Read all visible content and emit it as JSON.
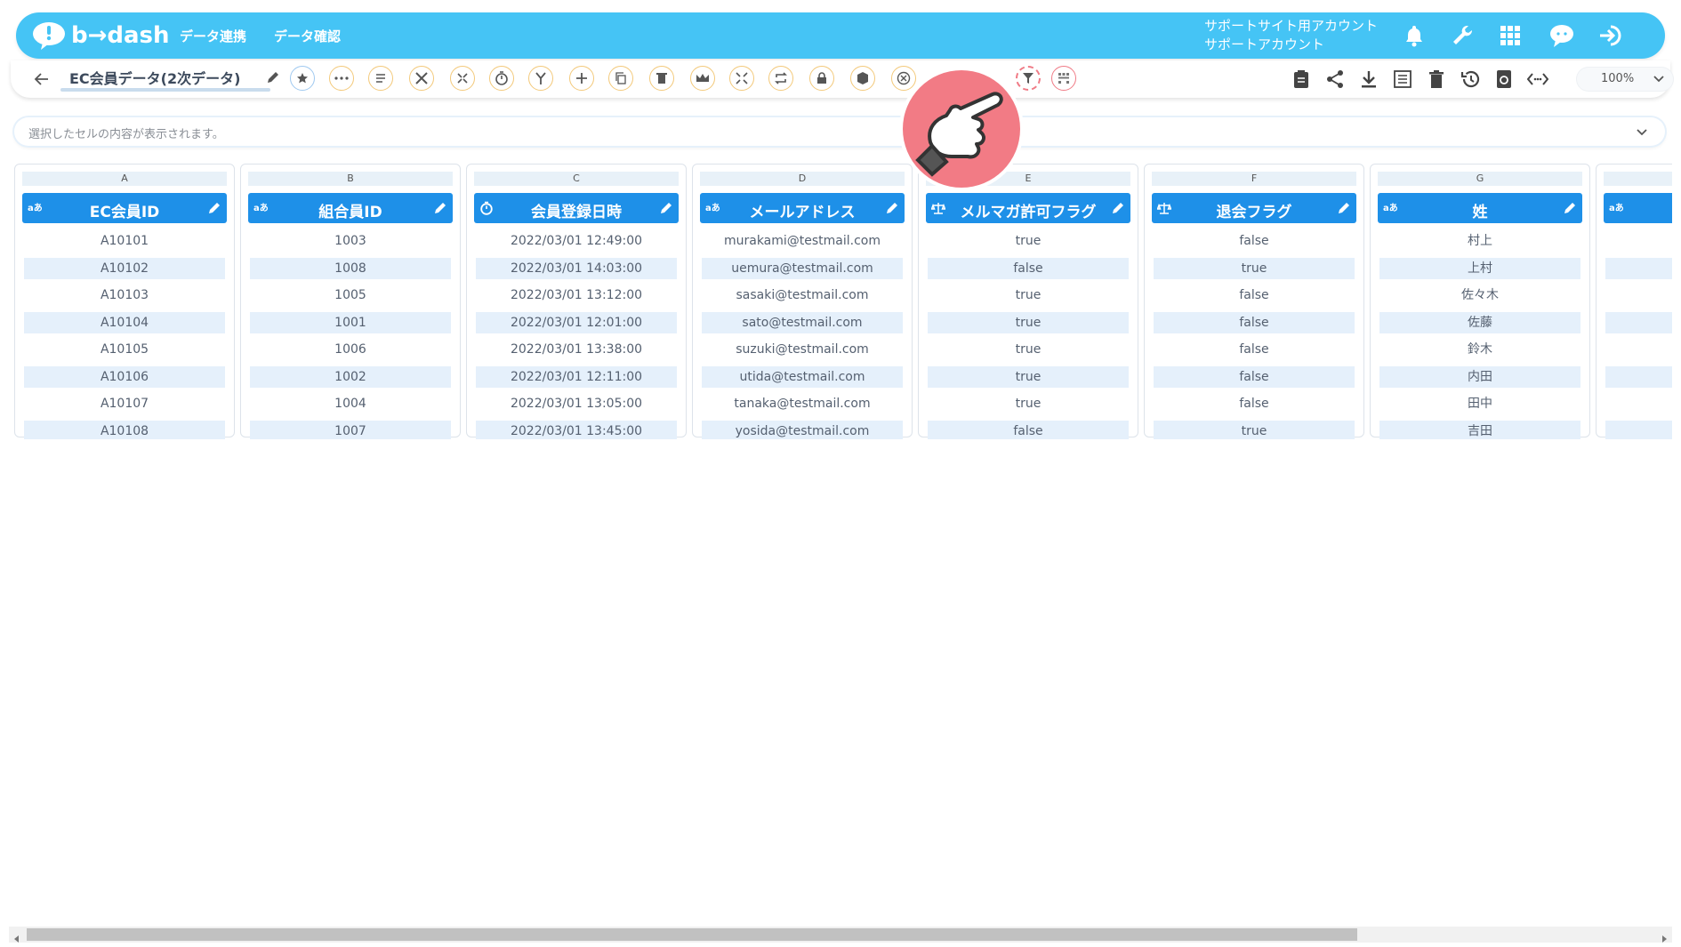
{
  "header": {
    "logo_text": "b→dash",
    "nav": [
      "データ連携",
      "データ確認"
    ],
    "account_line1": "サポートサイト用アカウント",
    "account_line2": "サポートアカウント"
  },
  "toolbar": {
    "title": "EC会員データ(2次データ)",
    "zoom": "100%"
  },
  "cellbar": {
    "placeholder": "選択したセルの内容が表示されます。"
  },
  "table": {
    "columns": [
      {
        "letter": "A",
        "name": "EC会員ID",
        "type": "text-icon",
        "values": [
          "A10101",
          "A10102",
          "A10103",
          "A10104",
          "A10105",
          "A10106",
          "A10107",
          "A10108"
        ]
      },
      {
        "letter": "B",
        "name": "組合員ID",
        "type": "text-icon",
        "values": [
          "1003",
          "1008",
          "1005",
          "1001",
          "1006",
          "1002",
          "1004",
          "1007"
        ]
      },
      {
        "letter": "C",
        "name": "会員登録日時",
        "type": "datetime-icon",
        "values": [
          "2022/03/01 12:49:00",
          "2022/03/01 14:03:00",
          "2022/03/01 13:12:00",
          "2022/03/01 12:01:00",
          "2022/03/01 13:38:00",
          "2022/03/01 12:11:00",
          "2022/03/01 13:05:00",
          "2022/03/01 13:45:00"
        ]
      },
      {
        "letter": "D",
        "name": "メールアドレス",
        "type": "text-icon",
        "values": [
          "murakami@testmail.com",
          "uemura@testmail.com",
          "sasaki@testmail.com",
          "sato@testmail.com",
          "suzuki@testmail.com",
          "utida@testmail.com",
          "tanaka@testmail.com",
          "yosida@testmail.com"
        ]
      },
      {
        "letter": "E",
        "name": "メルマガ許可フラグ",
        "type": "boolean-icon",
        "values": [
          "true",
          "false",
          "true",
          "true",
          "true",
          "true",
          "true",
          "false"
        ]
      },
      {
        "letter": "F",
        "name": "退会フラグ",
        "type": "boolean-icon",
        "values": [
          "false",
          "true",
          "false",
          "false",
          "false",
          "false",
          "false",
          "true"
        ]
      },
      {
        "letter": "G",
        "name": "姓",
        "type": "text-icon",
        "values": [
          "村上",
          "上村",
          "佐々木",
          "佐藤",
          "鈴木",
          "内田",
          "田中",
          "吉田"
        ]
      }
    ]
  },
  "colors": {
    "header_bg": "#45c4f5",
    "column_header_bg": "#1e90e8",
    "alt_row_bg": "#e5f0fb",
    "highlight_red": "#f07b86"
  }
}
